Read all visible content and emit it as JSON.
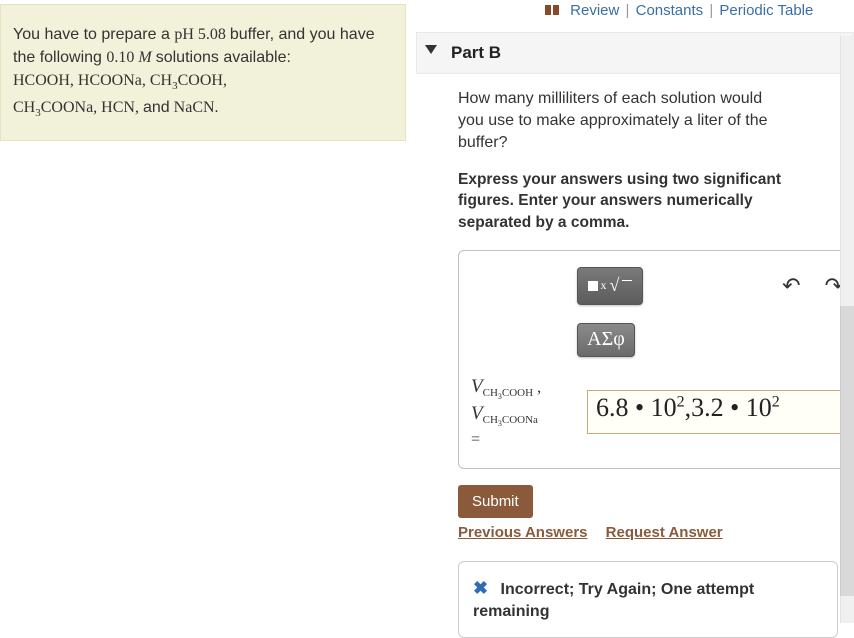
{
  "problem": {
    "intro_before_ph": "You have to prepare a ",
    "ph_label": "pH",
    "ph_value": "5.08",
    "intro_after_ph": " buffer, and you have the following ",
    "conc": "0.10",
    "conc_unit": "M",
    "intro_after_conc": " solutions available:",
    "chems_line": "HCOOH, HCOONa, CH₃COOH,",
    "chems_line2": "CH₃COONa, HCN, and NaCN."
  },
  "toplinks": {
    "review": "Review",
    "constants": "Constants",
    "periodic": "Periodic Table"
  },
  "part": {
    "label": "Part B",
    "question": "How many milliliters of each solution would you use to make approximately a liter of the buffer?",
    "instruction": "Express your answers using two significant figures. Enter your answers numerically separated by a comma."
  },
  "toolbar": {
    "templates_icon": "x√",
    "greek_label": "ΑΣφ",
    "undo_icon": "↶",
    "redo_icon": "↷"
  },
  "answer": {
    "var1_html": "V_CH3COOH",
    "var2_html": "V_CH3COONa",
    "equals": "=",
    "value_display": "6.8 • 10²,3.2 • 10²"
  },
  "buttons": {
    "submit": "Submit",
    "previous": "Previous Answers",
    "request": "Request Answer"
  },
  "feedback": {
    "icon": "✖",
    "text": "Incorrect; Try Again; One attempt remaining"
  },
  "chart_data": null
}
